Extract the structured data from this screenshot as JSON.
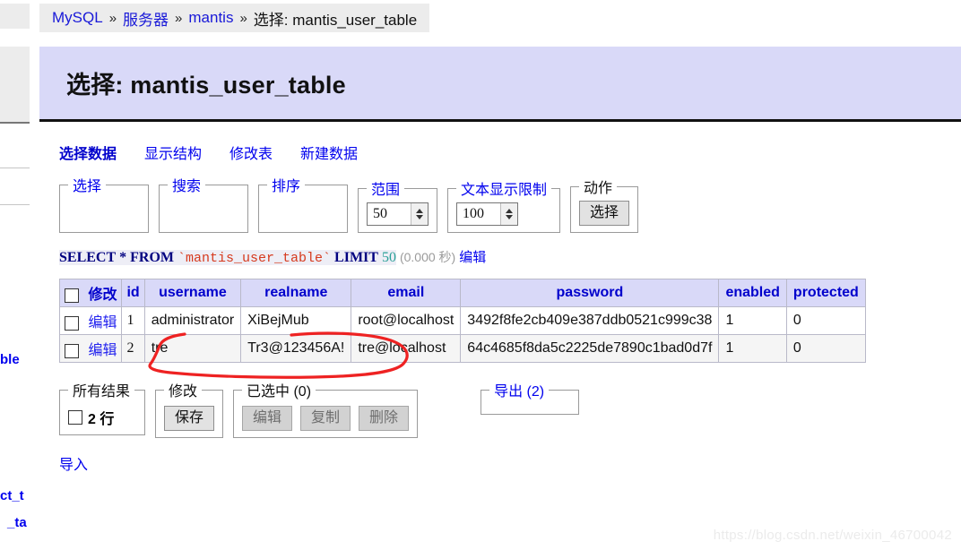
{
  "breadcrumb": {
    "items": [
      "MySQL",
      "服务器",
      "mantis"
    ],
    "separator": "»",
    "current": "选择: mantis_user_table"
  },
  "page_title": "选择: mantis_user_table",
  "tabs": [
    {
      "label": "选择数据",
      "active": true
    },
    {
      "label": "显示结构",
      "active": false
    },
    {
      "label": "修改表",
      "active": false
    },
    {
      "label": "新建数据",
      "active": false
    }
  ],
  "filters": {
    "select": {
      "legend": "选择"
    },
    "search": {
      "legend": "搜索"
    },
    "sort": {
      "legend": "排序"
    },
    "limit": {
      "legend": "范围",
      "value": "50"
    },
    "text_limit": {
      "legend": "文本显示限制",
      "value": "100"
    },
    "action": {
      "legend": "动作",
      "button": "选择"
    }
  },
  "sql": {
    "keyword_select": "SELECT",
    "star": "*",
    "keyword_from": "FROM",
    "table": "`mantis_user_table`",
    "keyword_limit": "LIMIT",
    "limit_value": "50",
    "timing": "(0.000 秒)",
    "edit_link": "编辑"
  },
  "grid": {
    "headers": [
      "修改",
      "id",
      "username",
      "realname",
      "email",
      "password",
      "enabled",
      "protected"
    ],
    "row_action_label": "编辑",
    "rows": [
      {
        "id": "1",
        "username": "administrator",
        "realname": "XiBejMub",
        "email": "root@localhost",
        "password": "3492f8fe2cb409e387ddb0521c999c38",
        "enabled": "1",
        "protected": "0"
      },
      {
        "id": "2",
        "username": "tre",
        "realname": "Tr3@123456A!",
        "email": "tre@localhost",
        "password": "64c4685f8da5c2225de7890c1bad0d7f",
        "enabled": "1",
        "protected": "0"
      }
    ]
  },
  "footer": {
    "all_results": {
      "legend": "所有结果",
      "rows_label": "2 行"
    },
    "modify": {
      "legend": "修改",
      "save_button": "保存"
    },
    "selected": {
      "legend": "已选中 (0)",
      "buttons": [
        "编辑",
        "复制",
        "删除"
      ]
    },
    "export": {
      "legend": "导出 (2)"
    },
    "import_link": "导入"
  },
  "sidebar_fragments": {
    "mid": "ble",
    "lower_1": "ct_t",
    "lower_2": "_ta"
  },
  "annotation": {
    "color": "#ee2222",
    "shape": "hand-drawn-ellipse"
  },
  "watermark": "https://blog.csdn.net/weixin_46700042",
  "colors": {
    "header_lavender": "#d9d9f8",
    "link_blue": "#0000ee",
    "chrome_gray": "#ececec",
    "annotation_red": "#ee2222"
  }
}
